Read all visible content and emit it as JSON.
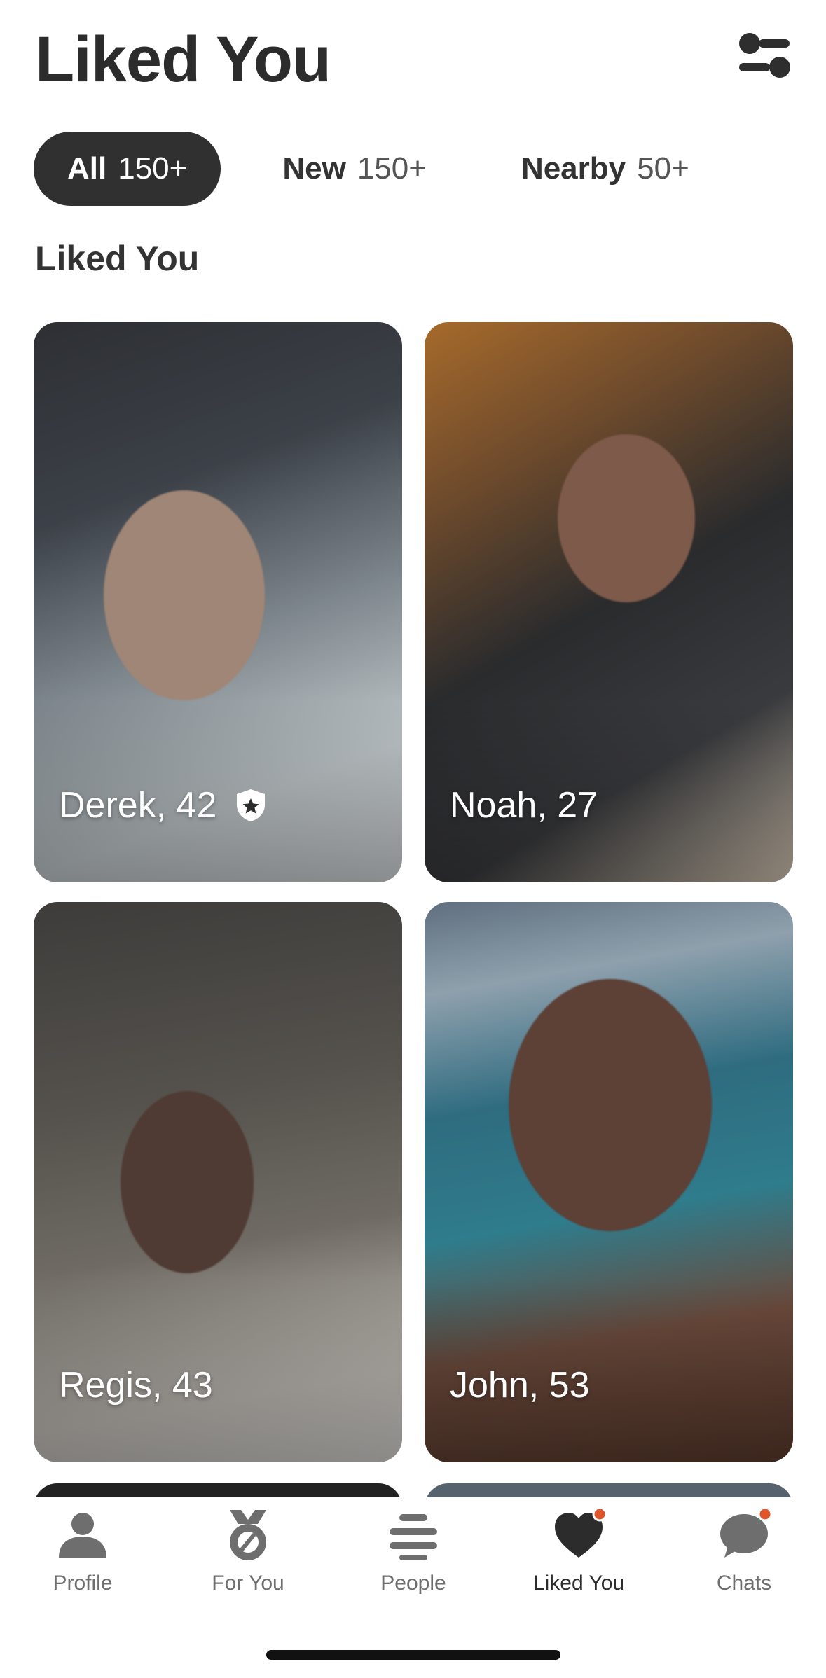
{
  "header": {
    "title": "Liked You",
    "filter_icon": "filter-sliders-icon"
  },
  "tabs": [
    {
      "label": "All",
      "count": "150+",
      "active": true
    },
    {
      "label": "New",
      "count": "150+",
      "active": false
    },
    {
      "label": "Nearby",
      "count": "50+",
      "active": false
    }
  ],
  "section_title": "Liked You",
  "cards": [
    {
      "name": "Derek, 42",
      "verified": true
    },
    {
      "name": "Noah, 27",
      "verified": false
    },
    {
      "name": "Regis, 43",
      "verified": false
    },
    {
      "name": "John, 53",
      "verified": false
    }
  ],
  "bottom_nav": [
    {
      "label": "Profile",
      "icon": "person-icon"
    },
    {
      "label": "For You",
      "icon": "medal-icon"
    },
    {
      "label": "People",
      "icon": "stack-icon"
    },
    {
      "label": "Liked You",
      "icon": "heart-icon",
      "active": true,
      "notification_dot": true
    },
    {
      "label": "Chats",
      "icon": "chat-bubble-icon",
      "notification_dot": true
    }
  ],
  "colors": {
    "accent": "#e0552b",
    "active_tab_bg": "#303030",
    "text_primary": "#2c2c2c",
    "text_secondary": "#6e6e6e"
  }
}
